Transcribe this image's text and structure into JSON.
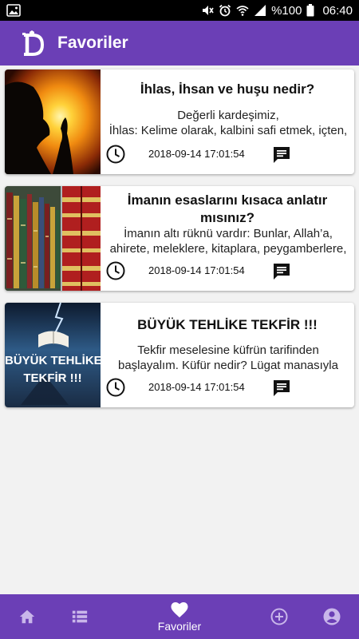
{
  "status_bar": {
    "battery": "%100",
    "time": "06:40",
    "icons": [
      "image-icon",
      "mute-icon",
      "alarm-icon",
      "wifi-icon",
      "signal-icon",
      "battery-icon"
    ]
  },
  "app_bar": {
    "logo_icon": "d-logo-icon",
    "title": "Favoriler"
  },
  "favorites": [
    {
      "title": "İhlas, İhsan ve huşu nedir?",
      "excerpt_line1": "Değerli kardeşimiz,",
      "excerpt_line2": "İhlas: Kelime olarak, kalbini safi etmek, içten,",
      "date": "2018-09-14 17:01:54",
      "thumbnail": "praying-silhouette-sunset"
    },
    {
      "title": "İmanın esaslarını kısaca anlatır mısınız?",
      "excerpt_line1": "İmanın altı rüknü vardır: Bunlar, Allah’a,",
      "excerpt_line2": "ahirete, meleklere, kitaplara, peygamberlere,",
      "date": "2018-09-14 17:01:54",
      "thumbnail": "bookshelf-library"
    },
    {
      "title": "BÜYÜK TEHLİKE TEKFİR !!!",
      "excerpt_line1": "Tekfir meselesine küfrün tarifinden",
      "excerpt_line2": "başlayalım. Küfür nedir? Lügat manasıyla",
      "date": "2018-09-14 17:01:54",
      "thumbnail": "book-lightning",
      "thumbnail_text_line1": "BÜYÜK TEHLİKE",
      "thumbnail_text_line2": "TEKFİR !!!"
    }
  ],
  "bottom_nav": {
    "items": [
      {
        "icon": "home-icon",
        "label": ""
      },
      {
        "icon": "list-icon",
        "label": ""
      },
      {
        "icon": "heart-icon",
        "label": "Favoriler",
        "active": true
      },
      {
        "icon": "add-circle-icon",
        "label": ""
      },
      {
        "icon": "account-icon",
        "label": ""
      }
    ]
  },
  "colors": {
    "primary": "#6b3fb6",
    "status_bar": "#000000",
    "background": "#f2f2f2",
    "card": "#ffffff"
  }
}
